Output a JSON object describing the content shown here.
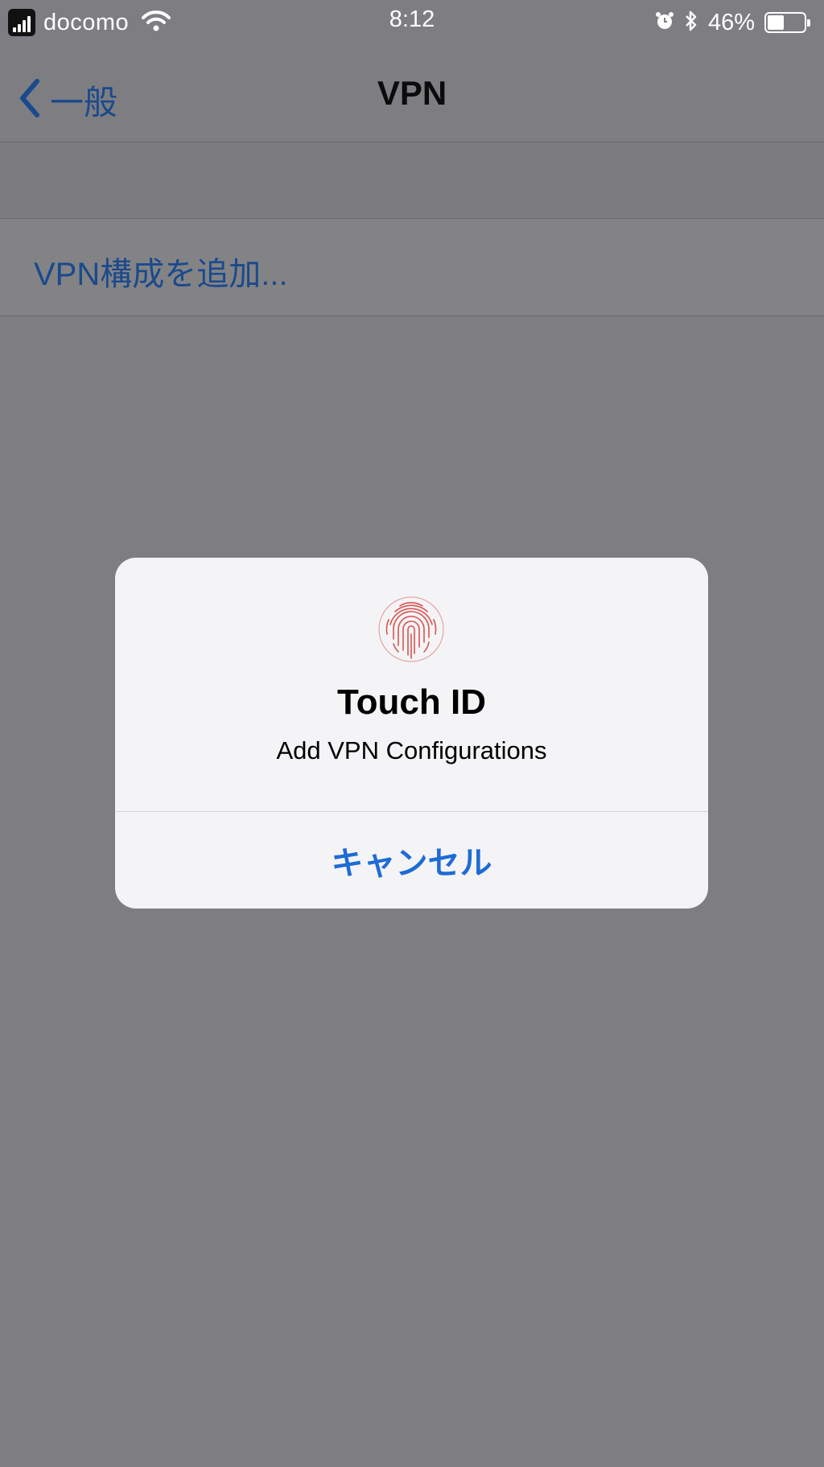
{
  "status_bar": {
    "carrier": "docomo",
    "time": "8:12",
    "battery_percent_text": "46%",
    "battery_level": 0.46
  },
  "nav": {
    "back_label": "一般",
    "title": "VPN"
  },
  "list": {
    "add_vpn_label": "VPN構成を追加..."
  },
  "alert": {
    "icon": "fingerprint-icon",
    "title": "Touch ID",
    "message": "Add VPN Configurations",
    "cancel_label": "キャンセル"
  },
  "colors": {
    "link_blue": "#1e6bd6",
    "fingerprint_red": "#d9534f",
    "dim_background": "#7e7e82"
  }
}
